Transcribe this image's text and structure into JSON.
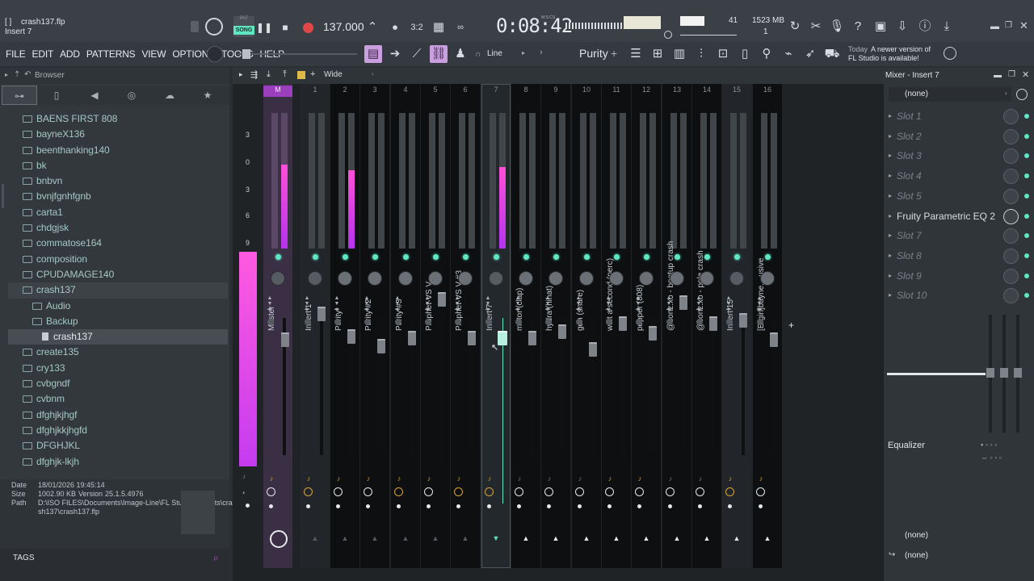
{
  "window": {
    "filename": "crash137.flp",
    "hint": "Insert 7"
  },
  "transport": {
    "pat_label": "PAT",
    "song_label": "SONG",
    "tempo": "137.000",
    "time": "0:08:42",
    "time_units": "M:S:CS",
    "cpu_value": "41",
    "memory": "1523 MB",
    "polyphony": "1"
  },
  "menu": [
    "FILE",
    "EDIT",
    "ADD",
    "PATTERNS",
    "VIEW",
    "OPTIONS",
    "TOOLS",
    "HELP"
  ],
  "toolbar": {
    "snap": "Line",
    "preset": "Purity"
  },
  "notice": {
    "day": "Today",
    "text": "A newer version of FL Studio is available!"
  },
  "browser": {
    "title": "Browser",
    "items": [
      {
        "label": "BAENS FIRST 808",
        "level": 0,
        "type": "folder"
      },
      {
        "label": "bayneX136",
        "level": 0,
        "type": "folder"
      },
      {
        "label": "beenthanking140",
        "level": 0,
        "type": "folder"
      },
      {
        "label": "bk",
        "level": 0,
        "type": "folder"
      },
      {
        "label": "bnbvn",
        "level": 0,
        "type": "folder"
      },
      {
        "label": "bvnjfgnhfgnb",
        "level": 0,
        "type": "folder"
      },
      {
        "label": "carta1",
        "level": 0,
        "type": "folder"
      },
      {
        "label": "chdgjsk",
        "level": 0,
        "type": "folder"
      },
      {
        "label": "commatose164",
        "level": 0,
        "type": "folder"
      },
      {
        "label": "composition",
        "level": 0,
        "type": "folder"
      },
      {
        "label": "CPUDAMAGE140",
        "level": 0,
        "type": "folder"
      },
      {
        "label": "crash137",
        "level": 0,
        "type": "folder",
        "open": true
      },
      {
        "label": "Audio",
        "level": 1,
        "type": "folder"
      },
      {
        "label": "Backup",
        "level": 1,
        "type": "folder"
      },
      {
        "label": "crash137",
        "level": 2,
        "type": "file",
        "selected": true
      },
      {
        "label": "create135",
        "level": 0,
        "type": "folder"
      },
      {
        "label": "cry133",
        "level": 0,
        "type": "folder"
      },
      {
        "label": "cvbgndf",
        "level": 0,
        "type": "folder"
      },
      {
        "label": "cvbnm",
        "level": 0,
        "type": "folder"
      },
      {
        "label": "dfghjkjhgf",
        "level": 0,
        "type": "folder"
      },
      {
        "label": "dfghjkkjhgfd",
        "level": 0,
        "type": "folder"
      },
      {
        "label": "DFGHJKL",
        "level": 0,
        "type": "folder"
      },
      {
        "label": "dfghjk-lkjh",
        "level": 0,
        "type": "folder"
      }
    ],
    "info": {
      "date_label": "Date",
      "date": "18/01/2026 19:45:14",
      "size_label": "Size",
      "size": "1002.90 KB",
      "version_label": "Version",
      "version": "25.1.5.4976",
      "path_label": "Path",
      "path_line1": "D:\\ISO FILES\\Documents\\Image-Line\\FL Studio\\Projects\\cra-",
      "path_line2": "sh137\\crash137.flp"
    },
    "tags_label": "TAGS"
  },
  "mixer": {
    "mode": "Wide",
    "scale": [
      "3",
      "0",
      "3",
      "6",
      "9"
    ],
    "strips": [
      {
        "num": "M",
        "name": "Master",
        "level": 0.62
      },
      {
        "num": "1",
        "name": "Insert 1",
        "level": 0
      },
      {
        "num": "2",
        "name": "Purity",
        "level": 0.58
      },
      {
        "num": "3",
        "name": "Purity #2",
        "level": 0
      },
      {
        "num": "4",
        "name": "Purity #3",
        "level": 0
      },
      {
        "num": "5",
        "name": "Prophet-VS V",
        "level": 0
      },
      {
        "num": "6",
        "name": "Prophet-VS V #3",
        "level": 0
      },
      {
        "num": "7",
        "name": "Insert 7",
        "level": 0.6
      },
      {
        "num": "8",
        "name": "motor (clap)",
        "level": 0
      },
      {
        "num": "9",
        "name": "hydra (hihat)",
        "level": 0
      },
      {
        "num": "10",
        "name": "gen (snare)",
        "level": 0
      },
      {
        "num": "11",
        "name": "wait a second (perc)",
        "level": 0
      },
      {
        "num": "12",
        "name": "pepper (808)",
        "level": 0
      },
      {
        "num": "13",
        "name": "@conz.xo - bootup crash",
        "level": 0
      },
      {
        "num": "14",
        "name": "@conz.xo - pole crash",
        "level": 0
      },
      {
        "num": "15",
        "name": "Insert 15",
        "level": 0
      },
      {
        "num": "16",
        "name": "[E-girl]bayne....usive",
        "level": 0
      }
    ]
  },
  "insert_panel": {
    "title": "Mixer - Insert 7",
    "input": "(none)",
    "slots": [
      "Slot 1",
      "Slot 2",
      "Slot 3",
      "Slot 4",
      "Slot 5",
      "Fruity Parametric EQ 2",
      "Slot 7",
      "Slot 8",
      "Slot 9",
      "Slot 10"
    ],
    "eq_label": "Equalizer",
    "output1": "(none)",
    "output2": "(none)"
  },
  "colors": {
    "accent": "#c14be6",
    "meter": "#e23cf0",
    "led": "#5fe6c2",
    "panel": "#33383d",
    "mixer_bg": "#1f2326"
  }
}
